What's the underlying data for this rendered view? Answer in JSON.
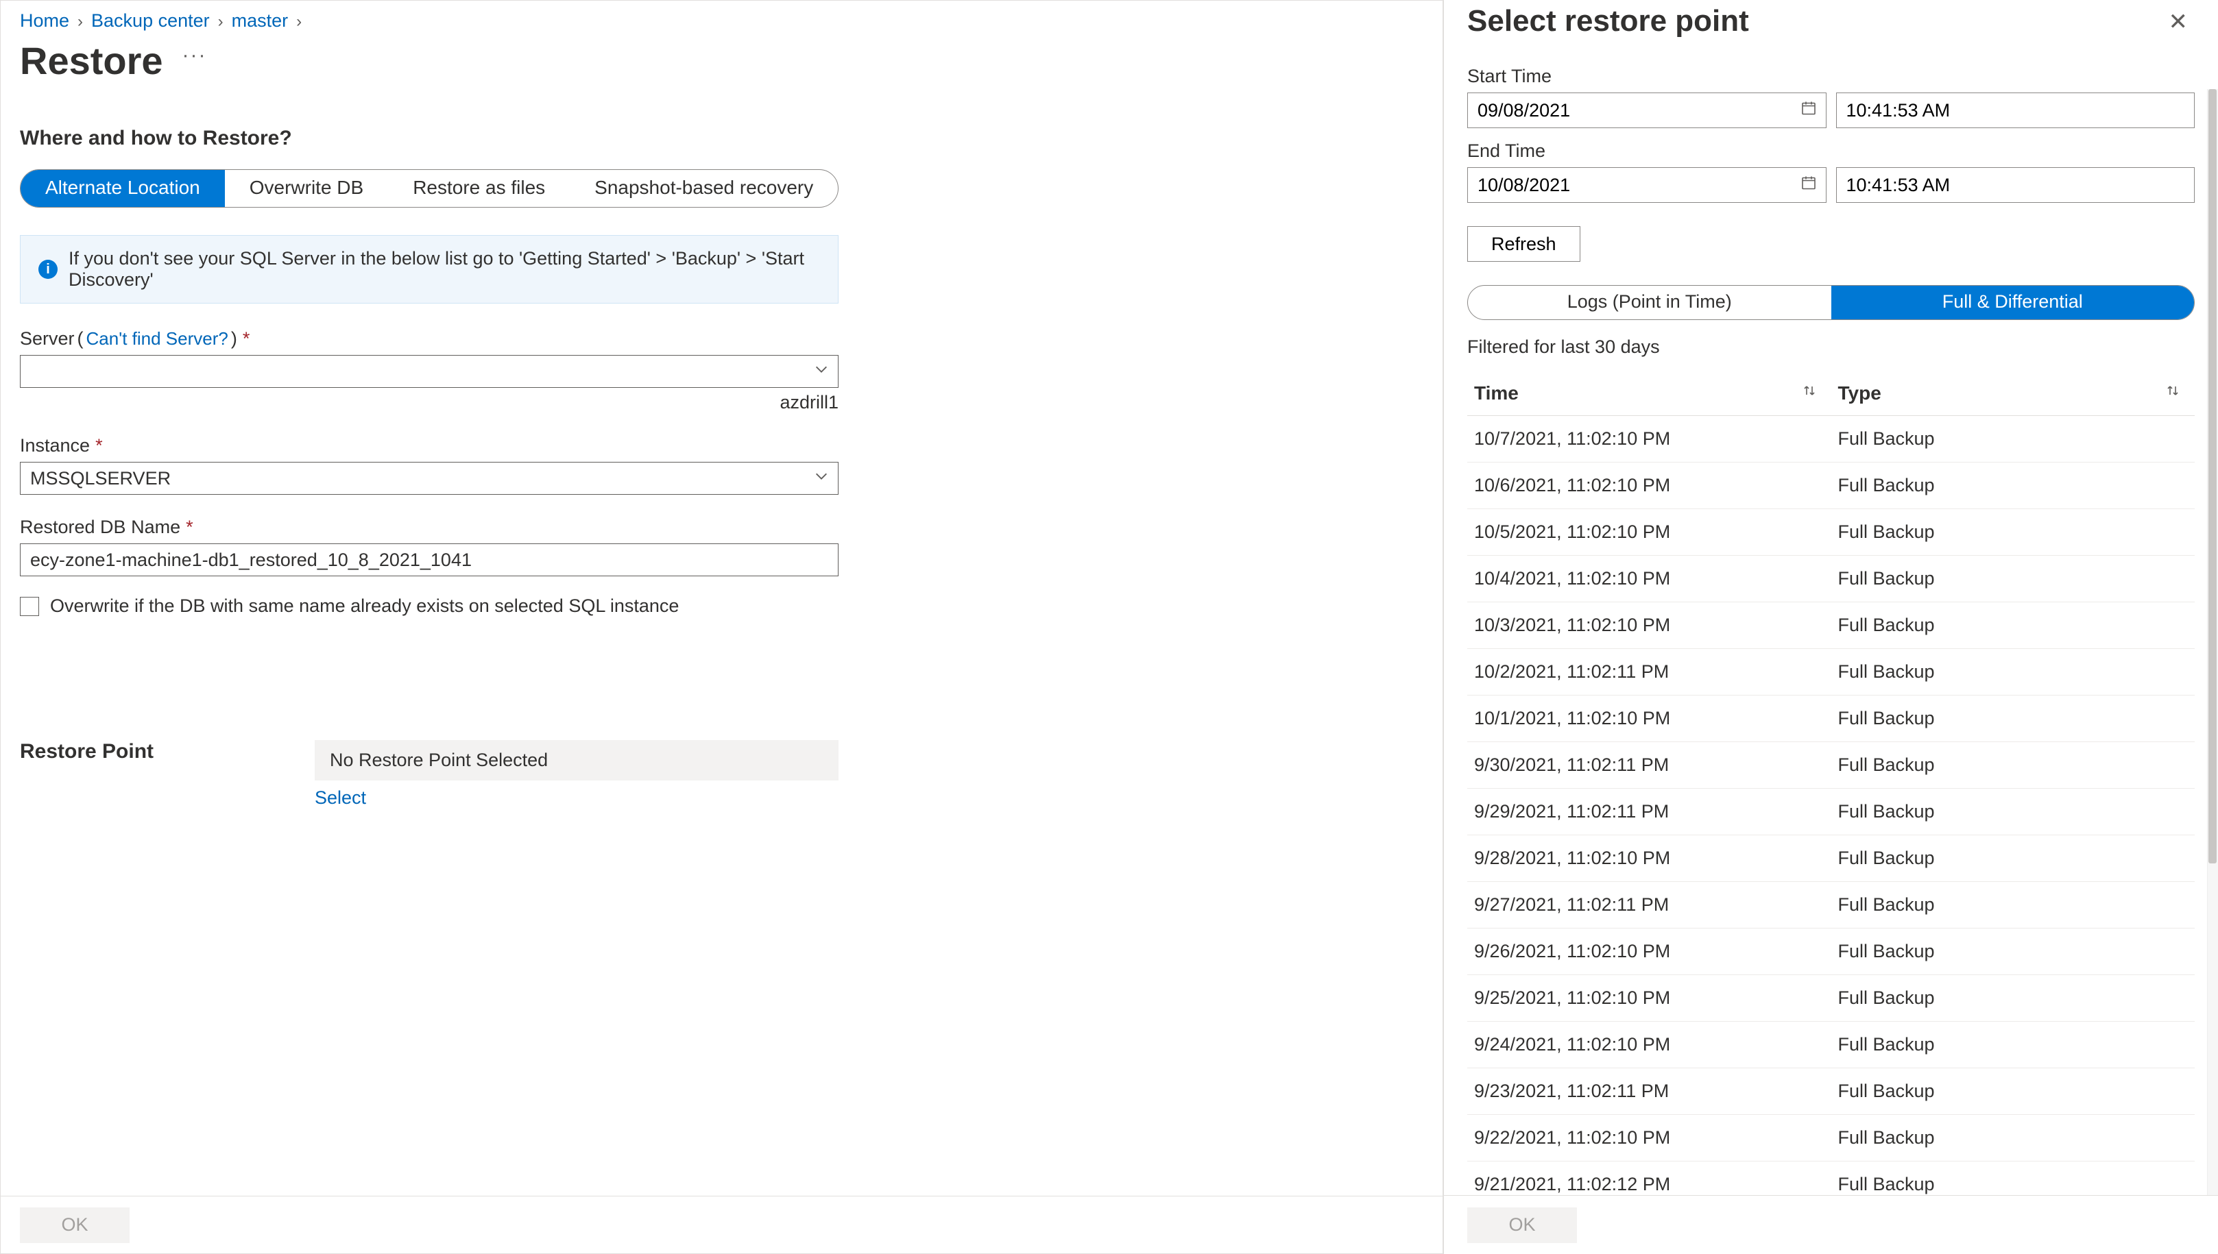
{
  "breadcrumb": {
    "home": "Home",
    "backup_center": "Backup center",
    "master": "master"
  },
  "page_title": "Restore",
  "section_where": "Where and how to Restore?",
  "restore_modes": {
    "alternate": "Alternate Location",
    "overwrite": "Overwrite DB",
    "files": "Restore as files",
    "snapshot": "Snapshot-based recovery"
  },
  "info_text": "If you don't see your SQL Server in the below list go to 'Getting Started' > 'Backup' > 'Start Discovery'",
  "server": {
    "label": "Server",
    "help_open": "(",
    "help": "Can't find Server?",
    "help_close": ")",
    "hint": "azdrill1"
  },
  "instance": {
    "label": "Instance",
    "value": "MSSQLSERVER"
  },
  "restored_db": {
    "label": "Restored DB Name",
    "value": "ecy-zone1-machine1-db1_restored_10_8_2021_1041"
  },
  "overwrite_checkbox": "Overwrite if the DB with same name already exists on selected SQL instance",
  "restore_point": {
    "label": "Restore Point",
    "none": "No Restore Point Selected",
    "select": "Select"
  },
  "ok": "OK",
  "panel": {
    "title": "Select restore point",
    "start_label": "Start Time",
    "start_date": "09/08/2021",
    "start_time": "10:41:53 AM",
    "end_label": "End Time",
    "end_date": "10/08/2021",
    "end_time": "10:41:53 AM",
    "refresh": "Refresh",
    "tabs": {
      "logs": "Logs (Point in Time)",
      "full": "Full & Differential"
    },
    "filter_text": "Filtered for last 30 days",
    "col_time": "Time",
    "col_type": "Type",
    "rows": [
      {
        "t": "10/7/2021, 11:02:10 PM",
        "y": "Full Backup"
      },
      {
        "t": "10/6/2021, 11:02:10 PM",
        "y": "Full Backup"
      },
      {
        "t": "10/5/2021, 11:02:10 PM",
        "y": "Full Backup"
      },
      {
        "t": "10/4/2021, 11:02:10 PM",
        "y": "Full Backup"
      },
      {
        "t": "10/3/2021, 11:02:10 PM",
        "y": "Full Backup"
      },
      {
        "t": "10/2/2021, 11:02:11 PM",
        "y": "Full Backup"
      },
      {
        "t": "10/1/2021, 11:02:10 PM",
        "y": "Full Backup"
      },
      {
        "t": "9/30/2021, 11:02:11 PM",
        "y": "Full Backup"
      },
      {
        "t": "9/29/2021, 11:02:11 PM",
        "y": "Full Backup"
      },
      {
        "t": "9/28/2021, 11:02:10 PM",
        "y": "Full Backup"
      },
      {
        "t": "9/27/2021, 11:02:11 PM",
        "y": "Full Backup"
      },
      {
        "t": "9/26/2021, 11:02:10 PM",
        "y": "Full Backup"
      },
      {
        "t": "9/25/2021, 11:02:10 PM",
        "y": "Full Backup"
      },
      {
        "t": "9/24/2021, 11:02:10 PM",
        "y": "Full Backup"
      },
      {
        "t": "9/23/2021, 11:02:11 PM",
        "y": "Full Backup"
      },
      {
        "t": "9/22/2021, 11:02:10 PM",
        "y": "Full Backup"
      },
      {
        "t": "9/21/2021, 11:02:12 PM",
        "y": "Full Backup"
      }
    ],
    "ok": "OK"
  }
}
